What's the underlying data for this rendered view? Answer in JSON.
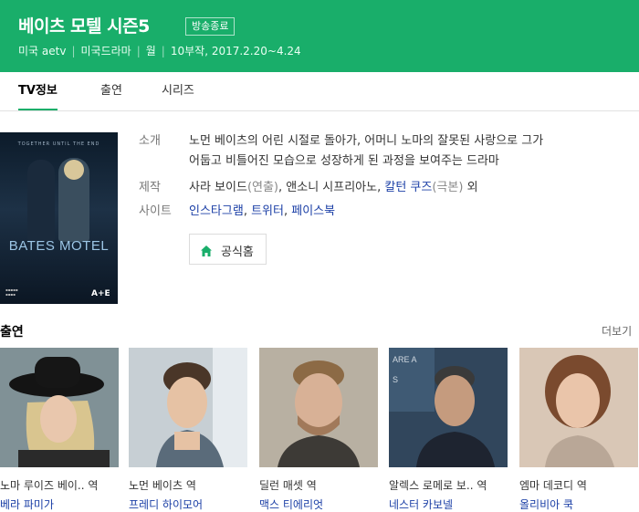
{
  "header": {
    "title": "베이츠 모텔 시즌5",
    "badge": "방송종료",
    "meta": [
      "미국 aetv",
      "미국드라마",
      "월",
      "10부작, 2017.2.20~4.24"
    ]
  },
  "tabs": [
    {
      "label": "TV정보",
      "active": true
    },
    {
      "label": "출연",
      "active": false
    },
    {
      "label": "시리즈",
      "active": false
    }
  ],
  "poster": {
    "tagline": "TOGETHER UNTIL THE END",
    "title_text": "BATES MOTEL",
    "network_logo": "A+E"
  },
  "info": {
    "intro_label": "소개",
    "intro_line1": "노먼 베이츠의 어린 시절로 돌아가, 어머니 노마의 잘못된 사랑으로 그가",
    "intro_line2": "어둡고 비틀어진 모습으로 성장하게 된 과정을 보여주는 드라마",
    "prod_label": "제작",
    "prod_name1": "사라 보이드",
    "prod_role1": "(연출)",
    "prod_name2": "앤소니 시프리아노",
    "prod_name3": "칼턴 쿠즈",
    "prod_role3": "(극본)",
    "prod_suffix": "외",
    "site_label": "사이트",
    "sites": [
      "인스타그램",
      "트위터",
      "페이스북"
    ]
  },
  "home_button": {
    "label": "공식홈",
    "icon": "home-icon",
    "color": "#19ae6a"
  },
  "cast": {
    "title": "출연",
    "more": "더보기",
    "members": [
      {
        "role": "노마 루이즈 베이.. 역",
        "actor": "베라 파미가"
      },
      {
        "role": "노먼 베이츠 역",
        "actor": "프레디 하이모어"
      },
      {
        "role": "딜런 매셋 역",
        "actor": "맥스 티에리엇"
      },
      {
        "role": "알렉스 로메로 보.. 역",
        "actor": "네스터 카보넬"
      },
      {
        "role": "엠마 데코디 역",
        "actor": "올리비아 쿡"
      }
    ]
  },
  "colors": {
    "brand": "#19ae6a",
    "link": "#1b3fa6"
  }
}
